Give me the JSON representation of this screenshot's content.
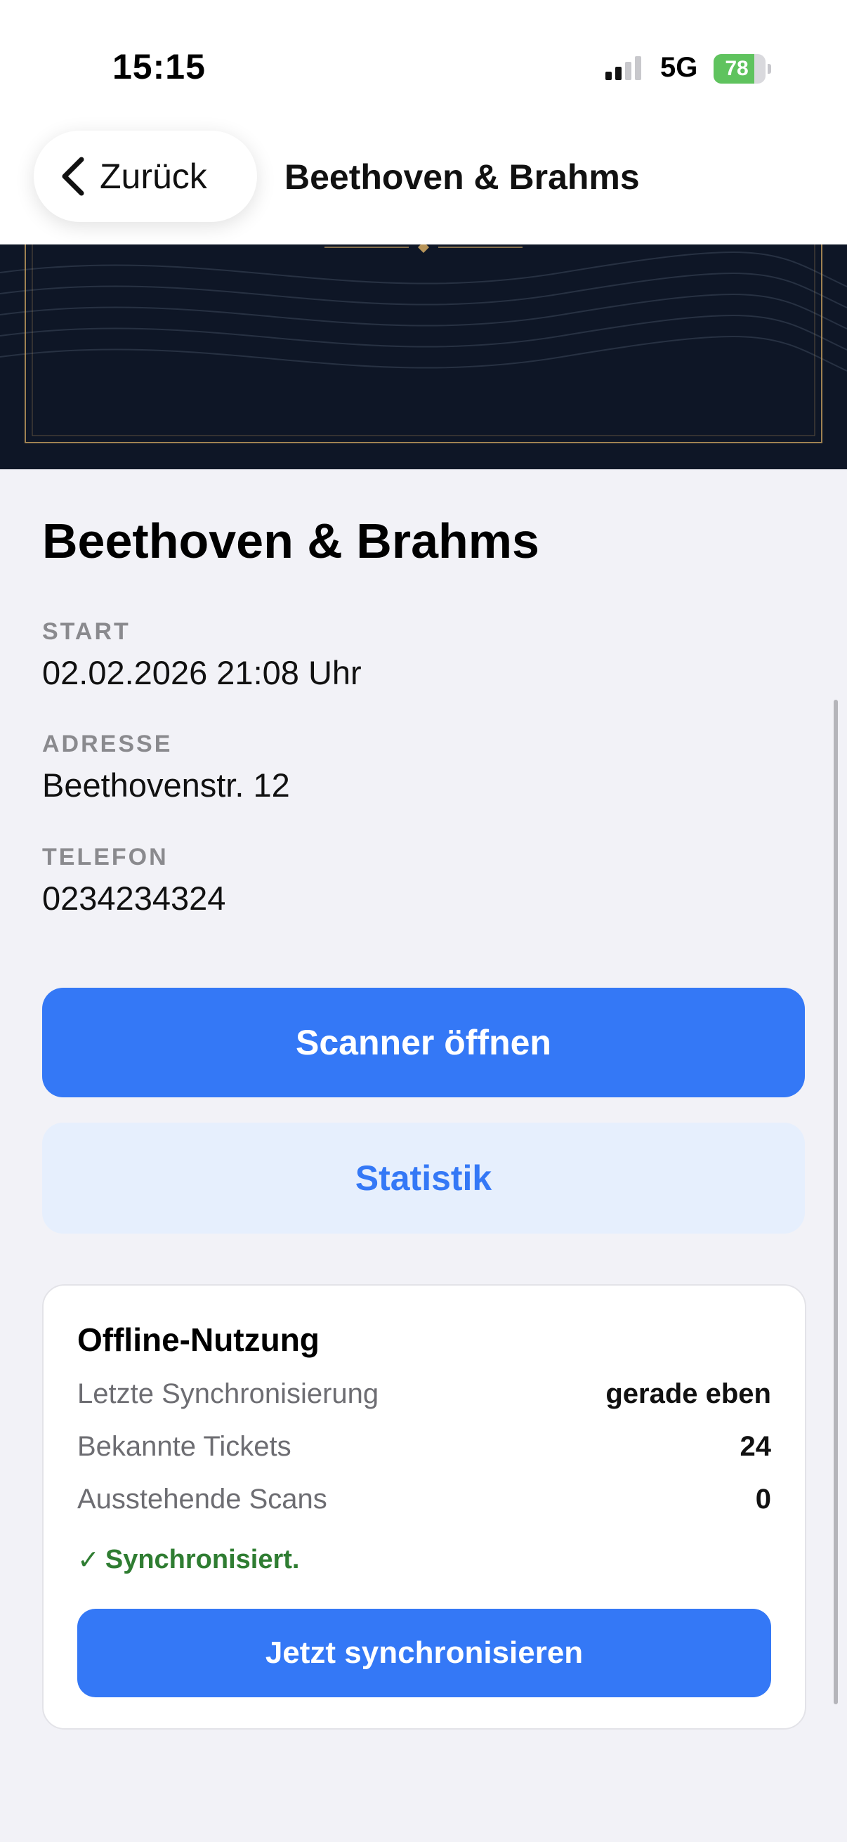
{
  "status_bar": {
    "time": "15:15",
    "network": "5G",
    "battery_percent": "78",
    "battery_level": 0.78,
    "battery_color": "#5fc35e"
  },
  "nav": {
    "back_label": "Zurück",
    "back_icon": "chevron-left-icon",
    "title": "Beethoven & Brahms"
  },
  "event": {
    "title": "Beethoven & Brahms",
    "fields": [
      {
        "label": "START",
        "value": "02.02.2026 21:08 Uhr"
      },
      {
        "label": "ADRESSE",
        "value": "Beethovenstr. 12"
      },
      {
        "label": "TELEFON",
        "value": "0234234324"
      }
    ]
  },
  "actions": {
    "scanner_label": "Scanner öffnen",
    "statistics_label": "Statistik"
  },
  "offline": {
    "title": "Offline-Nutzung",
    "rows": [
      {
        "key": "Letzte Synchronisierung",
        "value": "gerade eben"
      },
      {
        "key": "Bekannte Tickets",
        "value": "24"
      },
      {
        "key": "Ausstehende Scans",
        "value": "0"
      }
    ],
    "status_icon": "checkmark-icon",
    "status_mark": "✓",
    "status_text": "Synchronisiert.",
    "sync_button_label": "Jetzt synchronisieren"
  },
  "colors": {
    "accent": "#3478f6",
    "accent_soft": "#e6effd",
    "success": "#2f7d32",
    "hero_background": "#0e1626",
    "hero_gold": "#b8955a"
  }
}
